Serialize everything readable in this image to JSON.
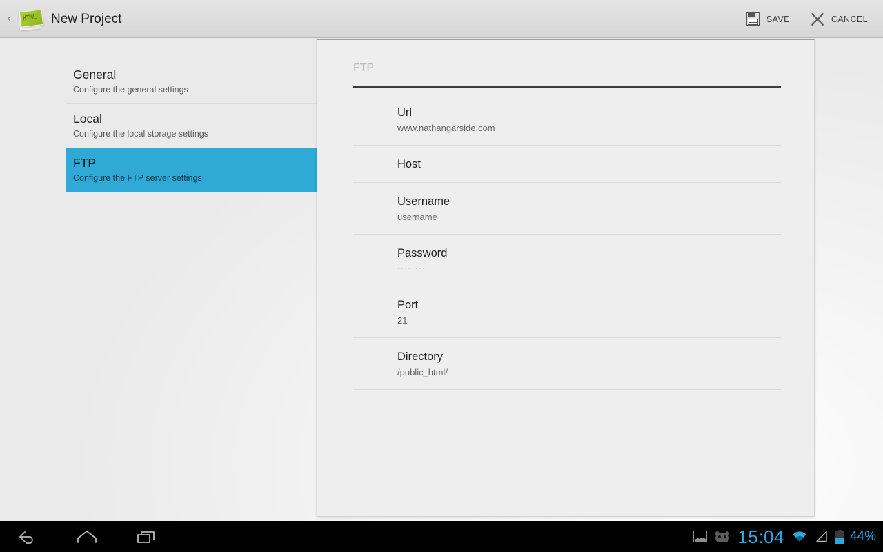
{
  "action_bar": {
    "back_chevron": "‹",
    "app_icon_name": "html-project-icon",
    "app_icon_tag": "HTML",
    "title": "New Project",
    "actions": [
      {
        "id": "save",
        "label": "SAVE",
        "icon": "floppy-disk-icon"
      },
      {
        "id": "cancel",
        "label": "CANCEL",
        "icon": "close-x-icon"
      }
    ]
  },
  "sidebar": {
    "items": [
      {
        "title": "General",
        "subtitle": "Configure the general settings",
        "selected": false
      },
      {
        "title": "Local",
        "subtitle": "Configure the local storage settings",
        "selected": false
      },
      {
        "title": "FTP",
        "subtitle": "Configure the FTP server settings",
        "selected": true
      }
    ],
    "selected_color": "#2fa9d6"
  },
  "ftp_panel": {
    "header": "FTP",
    "fields": [
      {
        "label": "Url",
        "value": "www.nathangarside.com",
        "masked": false
      },
      {
        "label": "Host",
        "value": "",
        "masked": false
      },
      {
        "label": "Username",
        "value": "username",
        "masked": false
      },
      {
        "label": "Password",
        "value": "········",
        "masked": true
      },
      {
        "label": "Port",
        "value": "21",
        "masked": false
      },
      {
        "label": "Directory",
        "value": "/public_html/",
        "masked": false
      }
    ]
  },
  "system_bar": {
    "nav": [
      {
        "id": "back",
        "icon": "back-arrow-icon"
      },
      {
        "id": "home",
        "icon": "home-icon"
      },
      {
        "id": "recent",
        "icon": "recent-apps-icon"
      }
    ],
    "status": {
      "screenshot_icon": "screenshot-icon",
      "bugdroid_icon": "android-bugdroid-icon",
      "clock": "15:04",
      "wifi_icon": "wifi-icon",
      "signal_icon": "cell-signal-icon",
      "battery_icon": "battery-icon",
      "battery_percent": "44%",
      "battery_level": 44,
      "accent_color": "#2ba7e0"
    }
  }
}
